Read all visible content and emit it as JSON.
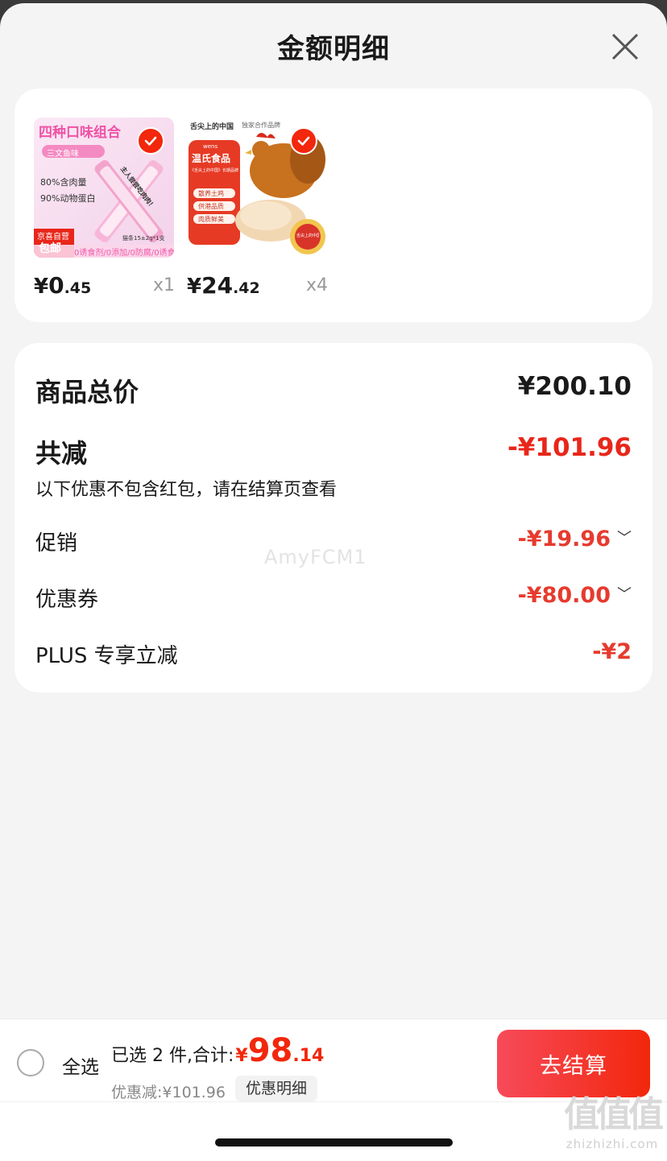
{
  "header": {
    "title": "金额明细"
  },
  "products": [
    {
      "price_currency": "¥",
      "price_int": "0",
      "price_dec": ".45",
      "qty": "x1",
      "image": {
        "title": "四种口味组合",
        "tag": "三文鱼味",
        "line1": "80%含肉量",
        "line2": "90%动物蛋白",
        "stick_text": "主人尝尝吃肉肉！",
        "spec": "猫条15±2g*1支",
        "corner_top": "京喜自营",
        "corner_bottom": "包邮",
        "footer": "0诱食剂/0添加/0防腐/0诱食"
      }
    },
    {
      "price_currency": "¥",
      "price_int": "24",
      "price_dec": ".42",
      "qty": "x4",
      "image": {
        "brand_top": "舌尖上的中国",
        "partner": "独家合作品牌",
        "logo_small": "wens",
        "logo": "温氏食品",
        "banner": "《舌尖上的中国》长期品牌",
        "feat1": "散养土鸡",
        "feat2": "供港品质",
        "feat3": "肉质鲜美",
        "seal": "舌尖上的中国"
      }
    }
  ],
  "summary": {
    "total_label": "商品总价",
    "total_value": "¥200.10",
    "reduce_label": "共减",
    "reduce_value": "-¥101.96",
    "reduce_note": "以下优惠不包含红包，请在结算页查看",
    "promo_label": "促销",
    "promo_value": "-¥19.96",
    "coupon_label": "优惠券",
    "coupon_value": "-¥80.00",
    "plus_label": "PLUS 专享立减",
    "plus_value": "-¥2"
  },
  "watermark": "AmyFCM1",
  "bottom": {
    "select_all": "全选",
    "selected_text": "已选 2 件,合计:",
    "total_currency": "¥",
    "total_int": "98",
    "total_dec": ".14",
    "discount_text": "优惠减:¥101.96",
    "detail_button": "优惠明细",
    "checkout_button": "去结算"
  },
  "corner_logo": {
    "mark": "值值值",
    "site": "zhizhizhi.com"
  },
  "colors": {
    "accent": "#f2270c",
    "discount_red": "#e63b2e",
    "background": "#f4f4f4"
  }
}
